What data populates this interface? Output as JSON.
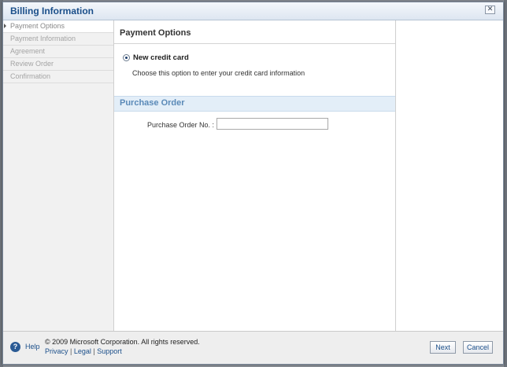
{
  "dialog": {
    "title": "Billing Information",
    "close_glyph": "✕"
  },
  "nav": {
    "items": [
      {
        "label": "Payment Options",
        "active": true
      },
      {
        "label": "Payment Information",
        "active": false
      },
      {
        "label": "Agreement",
        "active": false
      },
      {
        "label": "Review Order",
        "active": false
      },
      {
        "label": "Confirmation",
        "active": false
      }
    ]
  },
  "main": {
    "section_title": "Payment Options",
    "option": {
      "label": "New credit card",
      "description": "Choose this option to enter your credit card information",
      "selected": true
    },
    "purchase_order": {
      "title": "Purchase Order",
      "field_label": "Purchase Order No. :",
      "field_value": "",
      "field_placeholder": ""
    }
  },
  "footer": {
    "help_glyph": "?",
    "help_label": "Help",
    "copyright": "© 2009 Microsoft Corporation. All rights reserved.",
    "links": [
      "Privacy",
      "Legal",
      "Support"
    ],
    "link_separator": " | ",
    "next_label": "Next",
    "cancel_label": "Cancel"
  },
  "colors": {
    "accent": "#1b4f8a",
    "band": "#e3eef8",
    "band_text": "#5b8ab8"
  },
  "icons": {
    "close": "close-icon",
    "help": "help-icon",
    "radio": "radio-selected-icon",
    "nav_marker": "arrow-right-icon"
  }
}
